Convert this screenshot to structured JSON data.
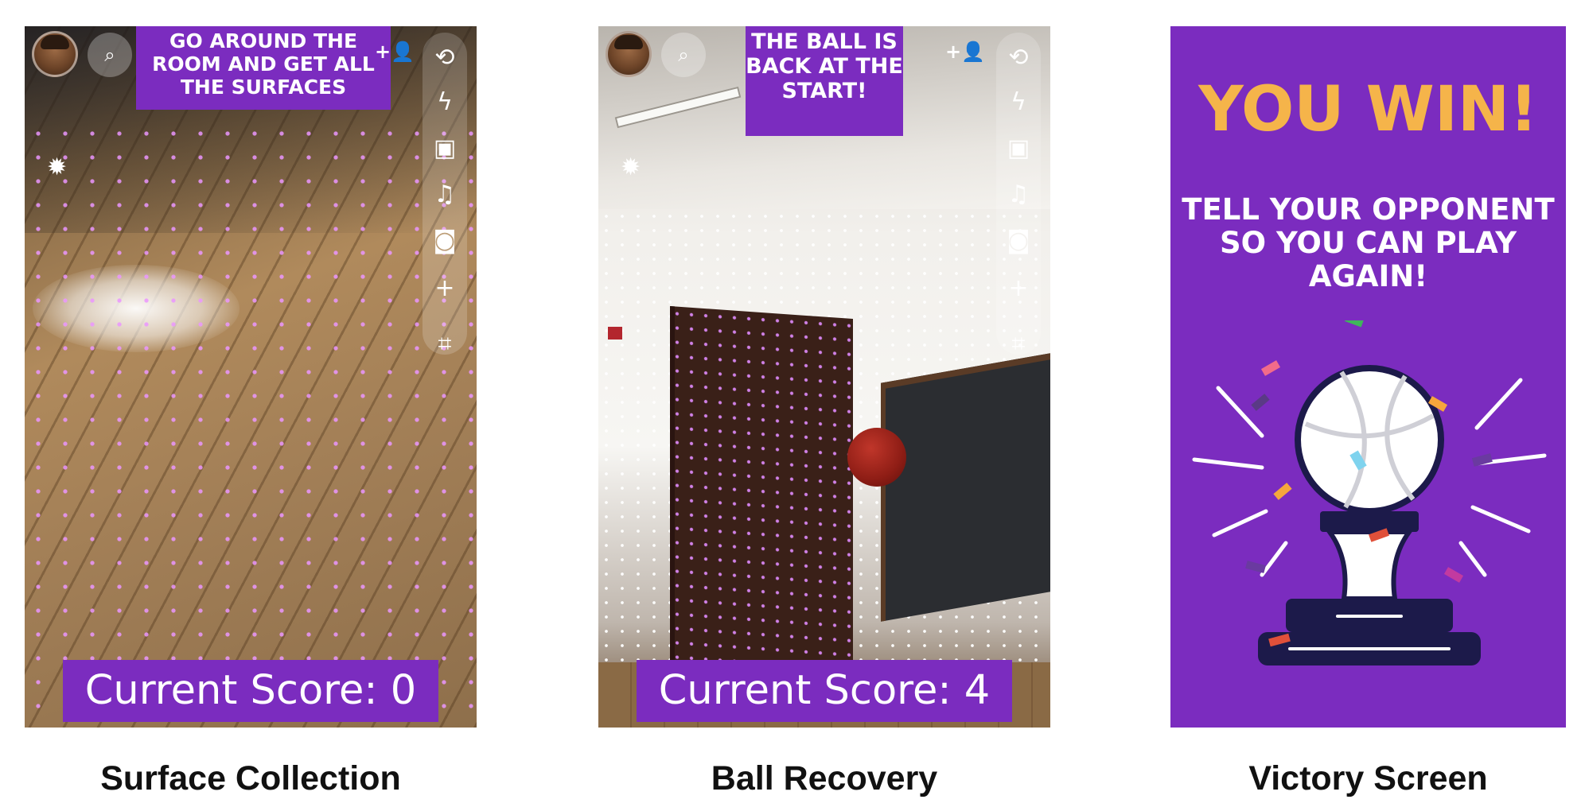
{
  "panels": [
    {
      "banner": "GO AROUND THE ROOM AND GET ALL THE SURFACES",
      "score": "Current Score: 0",
      "caption": "Surface Collection"
    },
    {
      "banner": "THE BALL IS BACK AT THE START!",
      "score": "Current Score: 4",
      "caption": "Ball Recovery"
    },
    {
      "title": "YOU WIN!",
      "message": "TELL YOUR OPPONENT SO YOU CAN PLAY AGAIN!",
      "caption": "Victory Screen"
    }
  ],
  "camera_ui": {
    "top_left": [
      "avatar-icon",
      "search-icon"
    ],
    "top_right": "add-friend-icon",
    "rail_icons": [
      "flip-camera-icon",
      "flash-icon",
      "video-chat-icon",
      "music-icon",
      "camera-roll-icon",
      "plus-icon",
      "scan-icon"
    ],
    "left_icon": "bug-icon"
  },
  "colors": {
    "banner_purple": "#7b2cbf",
    "win_yellow": "#f5b44a",
    "trophy_navy": "#1c1a4a"
  }
}
